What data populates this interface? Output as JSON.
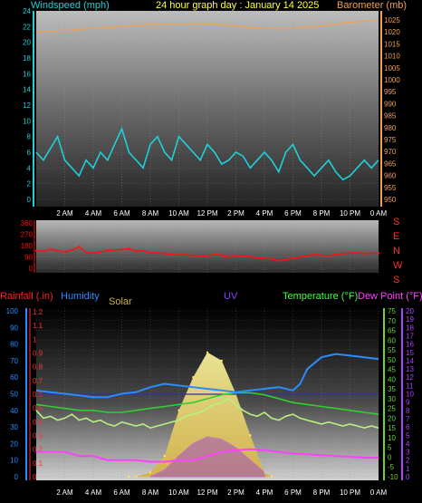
{
  "header": {
    "left_label": "Windspeed (mph)",
    "title": "24 hour graph day : January 14 2025",
    "right_label": "Barometer (mb)"
  },
  "direction_letters": [
    "S",
    "E",
    "N",
    "W",
    "S"
  ],
  "bottom_header": {
    "rain": "Rainfall (.in)",
    "humidity": "Humidity",
    "solar": "Solar",
    "uv": "UV",
    "temperature": "Temperature (°F)",
    "dewpoint": "Dew Point (°F)"
  },
  "colors": {
    "windspeed": "#1fd0d8",
    "barometer": "#f0a050",
    "direction": "#ff1010",
    "rain_axis": "#ff3030",
    "humidity": "#2a8cff",
    "solar": "#ffe84a",
    "uv": "#b040ff",
    "temperature": "#6bd62d",
    "dewpoint": "#ff40ff",
    "title": "#ffff40"
  },
  "chart_data": [
    {
      "type": "line",
      "name": "wind-barometer",
      "x_ticks": [
        "2 AM",
        "4 AM",
        "6 AM",
        "8 AM",
        "10 AM",
        "12 PM",
        "2 PM",
        "4 PM",
        "6 PM",
        "8 PM",
        "10 PM",
        "0 AM"
      ],
      "y_left_ticks": [
        "0",
        "2",
        "4",
        "6",
        "8",
        "10",
        "12",
        "14",
        "16",
        "18",
        "20",
        "22",
        "24"
      ],
      "ylim_left": [
        0,
        24
      ],
      "y_right_ticks": [
        "950",
        "955",
        "960",
        "965",
        "970",
        "975",
        "980",
        "985",
        "990",
        "995",
        "1000",
        "1005",
        "1010",
        "1015",
        "1020",
        "1025"
      ],
      "ylim_right": [
        950,
        1025
      ],
      "xlim": [
        0,
        24
      ],
      "series": [
        {
          "key": "wind",
          "x": [
            0,
            0.5,
            1,
            1.5,
            2,
            2.5,
            3,
            3.5,
            4,
            4.5,
            5,
            5.5,
            6,
            6.5,
            7,
            7.5,
            8,
            8.5,
            9,
            9.5,
            10,
            10.5,
            11,
            11.5,
            12,
            12.5,
            13,
            13.5,
            14,
            14.5,
            15,
            15.5,
            16,
            16.5,
            17,
            17.5,
            18,
            18.5,
            19,
            19.5,
            20,
            20.5,
            21,
            21.5,
            22,
            22.5,
            23,
            23.5,
            24
          ],
          "values": [
            6,
            5,
            6.5,
            8,
            5,
            4,
            3,
            5,
            4,
            6,
            5,
            7,
            9,
            6,
            5,
            4,
            7,
            8,
            6,
            5,
            8,
            7,
            6,
            5,
            7,
            6,
            4.5,
            5,
            6,
            5.5,
            4,
            5,
            6,
            5,
            3.5,
            6,
            7,
            5,
            4,
            3,
            4,
            5,
            3.5,
            2.5,
            3,
            4,
            5,
            4,
            5
          ]
        },
        {
          "key": "barometer",
          "x": [
            0,
            1,
            2,
            3,
            4,
            5,
            6,
            7,
            8,
            9,
            10,
            11,
            12,
            13,
            14,
            15,
            16,
            17,
            18,
            19,
            20,
            21,
            22,
            23,
            24
          ],
          "values": [
            1020,
            1020.3,
            1020.7,
            1021,
            1021.5,
            1022,
            1022.3,
            1022.7,
            1023,
            1023.3,
            1023.6,
            1023.5,
            1023.3,
            1023,
            1022.5,
            1022,
            1021.5,
            1021.3,
            1021.5,
            1022,
            1022.5,
            1023.2,
            1024,
            1024.5,
            1024.8
          ]
        }
      ]
    },
    {
      "type": "scatter",
      "name": "wind-direction",
      "y_ticks": [
        "0",
        "90",
        "180",
        "270",
        "360"
      ],
      "ylim": [
        0,
        360
      ],
      "xlim": [
        0,
        24
      ],
      "series": [
        {
          "key": "direction",
          "x": [
            0,
            0.5,
            1,
            1.5,
            2,
            2.5,
            3,
            3.5,
            4,
            4.5,
            5,
            5.5,
            6,
            6.5,
            7,
            7.5,
            8,
            8.5,
            9,
            9.5,
            10,
            10.5,
            11,
            11.5,
            12,
            12.5,
            13,
            13.5,
            14,
            14.5,
            15,
            15.5,
            16,
            16.5,
            17,
            17.5,
            18,
            18.5,
            19,
            19.5,
            20,
            20.5,
            21,
            21.5,
            22,
            22.5,
            23,
            23.5,
            24
          ],
          "values": [
            140,
            135,
            150,
            140,
            130,
            145,
            170,
            125,
            120,
            130,
            140,
            145,
            150,
            155,
            135,
            140,
            120,
            125,
            115,
            110,
            105,
            110,
            100,
            95,
            100,
            110,
            105,
            90,
            95,
            100,
            90,
            85,
            80,
            75,
            60,
            70,
            80,
            90,
            100,
            110,
            105,
            100,
            110,
            115,
            120,
            125,
            115,
            120,
            118
          ]
        }
      ]
    },
    {
      "type": "line",
      "name": "rain-humidity-solar-uv-temp-dew",
      "x_ticks": [
        "2 AM",
        "4 AM",
        "6 AM",
        "8 AM",
        "10 AM",
        "12 PM",
        "2 PM",
        "4 PM",
        "6 PM",
        "8 PM",
        "10 PM",
        "0 AM"
      ],
      "rain_ticks": [
        "0",
        "0.1",
        "0.2",
        "0.3",
        "0.4",
        "0.5",
        "0.6",
        "0.7",
        "0.8",
        "0.9",
        "1",
        "1.1",
        "1.2"
      ],
      "rain_lim": [
        0,
        1.2
      ],
      "humidity_ticks": [
        "0",
        "10",
        "20",
        "30",
        "40",
        "50",
        "60",
        "70",
        "80",
        "90",
        "100"
      ],
      "humidity_lim": [
        0,
        100
      ],
      "temp_ticks": [
        "-10",
        "-5",
        "0",
        "5",
        "10",
        "15",
        "20",
        "25",
        "30",
        "35",
        "40",
        "45",
        "50",
        "55",
        "60",
        "65",
        "70",
        "75"
      ],
      "temp_lim": [
        -10,
        75
      ],
      "uv_ticks": [
        "0",
        "1",
        "2",
        "3",
        "4",
        "5",
        "6",
        "7",
        "8",
        "9",
        "10",
        "11",
        "12",
        "13",
        "14",
        "15",
        "16",
        "17",
        "18",
        "19",
        "20"
      ],
      "uv_lim": [
        0,
        20
      ],
      "xlim": [
        0,
        24
      ],
      "series": [
        {
          "key": "humidity",
          "x": [
            0,
            1,
            2,
            3,
            4,
            5,
            6,
            7,
            8,
            9,
            10,
            11,
            12,
            13,
            14,
            15,
            16,
            17,
            18,
            18.5,
            19,
            20,
            21,
            22,
            23,
            24
          ],
          "values": [
            52,
            51,
            50,
            49,
            48,
            48,
            50,
            51,
            54,
            56,
            55,
            54,
            53,
            52,
            51,
            52,
            53,
            54,
            52,
            56,
            65,
            72,
            74,
            73,
            72,
            71
          ]
        },
        {
          "key": "temperature",
          "x": [
            0,
            1,
            2,
            3,
            4,
            5,
            6,
            7,
            8,
            9,
            10,
            11,
            12,
            13,
            14,
            15,
            16,
            17,
            18,
            19,
            20,
            21,
            22,
            23,
            24
          ],
          "values": [
            27,
            26,
            25,
            24,
            24,
            23,
            23,
            24,
            25,
            26,
            27,
            28,
            30,
            32,
            33,
            33,
            32,
            30,
            28,
            27,
            26,
            25,
            24,
            23,
            22
          ]
        },
        {
          "key": "temperature_noisy",
          "x": [
            0,
            0.5,
            1,
            1.5,
            2,
            2.5,
            3,
            3.5,
            4,
            4.5,
            5,
            5.5,
            6,
            6.5,
            7,
            7.5,
            8,
            8.5,
            9,
            9.5,
            10,
            10.5,
            11,
            11.5,
            12,
            12.5,
            13,
            13.5,
            14,
            14.5,
            15,
            15.5,
            16,
            16.5,
            17,
            17.5,
            18,
            18.5,
            19,
            19.5,
            20,
            20.5,
            21,
            21.5,
            22,
            22.5,
            23,
            23.5,
            24
          ],
          "values": [
            24,
            20,
            21,
            19,
            20,
            22,
            19,
            20,
            18,
            19,
            17,
            16,
            18,
            17,
            16,
            17,
            15,
            16,
            17,
            18,
            19,
            21,
            22,
            23,
            25,
            27,
            28,
            30,
            27,
            24,
            22,
            21,
            23,
            20,
            19,
            21,
            22,
            20,
            19,
            18,
            17,
            18,
            17,
            16,
            17,
            16,
            15,
            16,
            15
          ]
        },
        {
          "key": "dewpoint",
          "x": [
            0,
            1,
            2,
            3,
            4,
            5,
            6,
            7,
            8,
            9,
            10,
            11,
            12,
            13,
            14,
            15,
            16,
            17,
            18,
            19,
            20,
            21,
            22,
            23,
            24
          ],
          "values": [
            3,
            3,
            3,
            2.5,
            2.5,
            2,
            2,
            2,
            1.8,
            1.8,
            2,
            2,
            2.5,
            3,
            3.2,
            3.3,
            3.2,
            3,
            2.8,
            2.7,
            2.6,
            2.5,
            2.4,
            2.3,
            2.3
          ]
        },
        {
          "key": "solar",
          "x": [
            6.5,
            7,
            8,
            9,
            10,
            11,
            12,
            13,
            14,
            15,
            16,
            16.5
          ],
          "values": [
            0,
            0,
            5,
            25,
            80,
            120,
            150,
            140,
            100,
            50,
            5,
            0
          ]
        },
        {
          "key": "uv",
          "x": [
            8,
            9,
            10,
            11,
            12,
            13,
            14,
            15,
            16
          ],
          "values": [
            0,
            0.8,
            2.5,
            4,
            4.8,
            4.5,
            3.5,
            2,
            0.5
          ]
        },
        {
          "key": "rain_level",
          "x": [
            0,
            24
          ],
          "values": [
            0.6,
            0.6
          ]
        }
      ]
    }
  ]
}
